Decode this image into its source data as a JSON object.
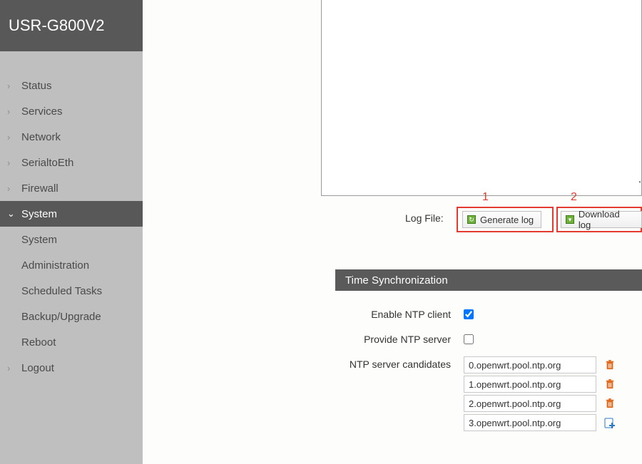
{
  "brand": "USR-G800V2",
  "nav": {
    "items": [
      {
        "label": "Status"
      },
      {
        "label": "Services"
      },
      {
        "label": "Network"
      },
      {
        "label": "SerialtoEth"
      },
      {
        "label": "Firewall"
      },
      {
        "label": "System",
        "active": true
      },
      {
        "label": "Logout"
      }
    ],
    "sub": [
      {
        "label": "System"
      },
      {
        "label": "Administration"
      },
      {
        "label": "Scheduled Tasks"
      },
      {
        "label": "Backup/Upgrade"
      },
      {
        "label": "Reboot"
      }
    ]
  },
  "annot": {
    "one": "1",
    "two": "2"
  },
  "log": {
    "label": "Log File:",
    "generate": "Generate log",
    "download": "Download log"
  },
  "timesync": {
    "heading": "Time Synchronization",
    "enable_label": "Enable NTP client",
    "provide_label": "Provide NTP server",
    "cand_label": "NTP server candidates",
    "servers": [
      "0.openwrt.pool.ntp.org",
      "1.openwrt.pool.ntp.org",
      "2.openwrt.pool.ntp.org",
      "3.openwrt.pool.ntp.org"
    ]
  }
}
